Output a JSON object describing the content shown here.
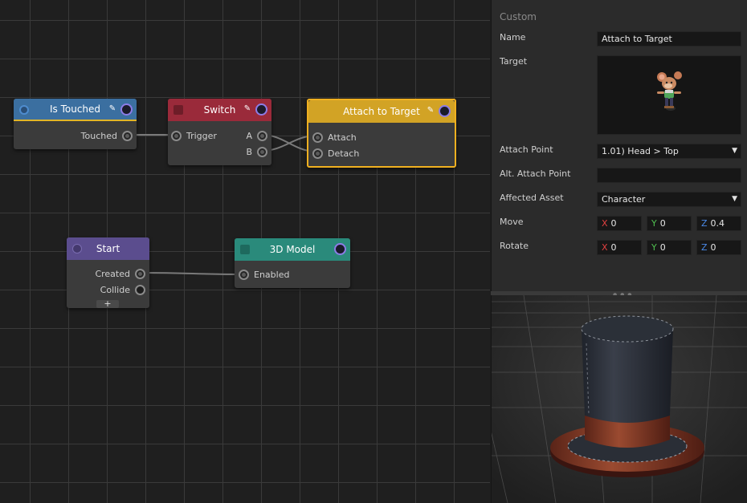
{
  "graph": {
    "nodes": {
      "is_touched": {
        "title": "Is Touched",
        "outputs": [
          "Touched"
        ],
        "color": "#3b6fa0"
      },
      "switch": {
        "title": "Switch",
        "inputs": [
          "Trigger"
        ],
        "outputs": [
          "A",
          "B"
        ],
        "color": "#9a2a3a"
      },
      "attach": {
        "title": "Attach to Target",
        "inputs": [
          "Attach",
          "Detach"
        ],
        "color": "#d2a325"
      },
      "start": {
        "title": "Start",
        "outputs": [
          "Created",
          "Collide"
        ],
        "add": "+",
        "color": "#5b4d8e"
      },
      "model": {
        "title": "3D Model",
        "inputs": [
          "Enabled"
        ],
        "color": "#2a8a7b"
      }
    }
  },
  "inspector": {
    "section": "Custom",
    "name_label": "Name",
    "name_value": "Attach to Target",
    "target_label": "Target",
    "attach_point_label": "Attach Point",
    "attach_point_value": "1.01) Head > Top",
    "alt_attach_label": "Alt. Attach Point",
    "alt_attach_value": "",
    "affected_label": "Affected Asset",
    "affected_value": "Character",
    "move_label": "Move",
    "move": {
      "x_axis": "X",
      "x": "0",
      "y_axis": "Y",
      "y": "0",
      "z_axis": "Z",
      "z": "0.4"
    },
    "rotate_label": "Rotate",
    "rotate": {
      "x_axis": "X",
      "x": "0",
      "y_axis": "Y",
      "y": "0",
      "z_axis": "Z",
      "z": "0"
    }
  },
  "colors": {
    "x_axis": "#e04040",
    "y_axis": "#50c050",
    "z_axis": "#4a8ae8",
    "selected_border": "#f0b020"
  }
}
